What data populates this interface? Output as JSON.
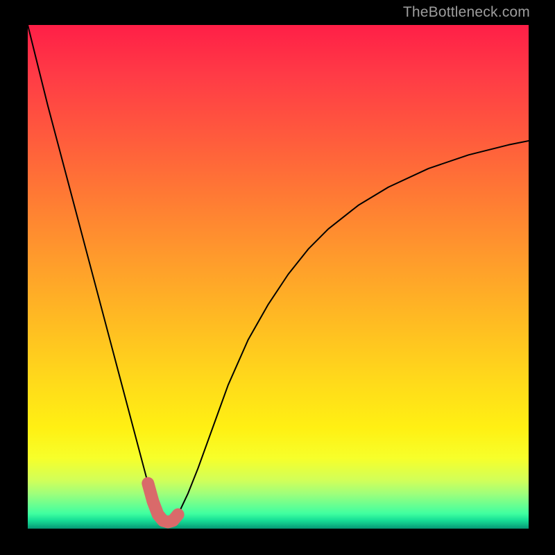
{
  "watermark": {
    "text": "TheBottleneck.com"
  },
  "chart_data": {
    "type": "line",
    "title": "",
    "xlabel": "",
    "ylabel": "",
    "xlim": [
      0,
      100
    ],
    "ylim": [
      0,
      100
    ],
    "grid": false,
    "series": [
      {
        "name": "bottleneck-curve",
        "x": [
          0,
          2,
          4,
          6,
          8,
          10,
          12,
          14,
          16,
          18,
          20,
          22,
          24,
          25,
          26,
          27,
          28,
          29,
          30,
          32,
          34,
          36,
          38,
          40,
          44,
          48,
          52,
          56,
          60,
          66,
          72,
          80,
          88,
          96,
          100
        ],
        "values": [
          100,
          92,
          84,
          76.5,
          69,
          61.5,
          54,
          46.5,
          39,
          31.5,
          24,
          16.5,
          9,
          5.4,
          2.8,
          1.6,
          1.3,
          1.6,
          2.8,
          7,
          12,
          17.5,
          23,
          28.5,
          37.5,
          44.5,
          50.5,
          55.5,
          59.5,
          64.2,
          67.8,
          71.5,
          74.2,
          76.2,
          77
        ]
      },
      {
        "name": "highlight-segment",
        "x": [
          24,
          25,
          26,
          27,
          28,
          29,
          30
        ],
        "values": [
          9,
          5.4,
          2.8,
          1.6,
          1.3,
          1.6,
          2.8
        ]
      }
    ],
    "background_gradient": {
      "orientation": "vertical",
      "stops": [
        {
          "pos": 0.0,
          "color": "#ff1f47"
        },
        {
          "pos": 0.5,
          "color": "#ffb020"
        },
        {
          "pos": 0.82,
          "color": "#fff013"
        },
        {
          "pos": 0.97,
          "color": "#40ffa0"
        },
        {
          "pos": 1.0,
          "color": "#059a74"
        }
      ]
    },
    "highlight_color": "#d96a6a"
  }
}
